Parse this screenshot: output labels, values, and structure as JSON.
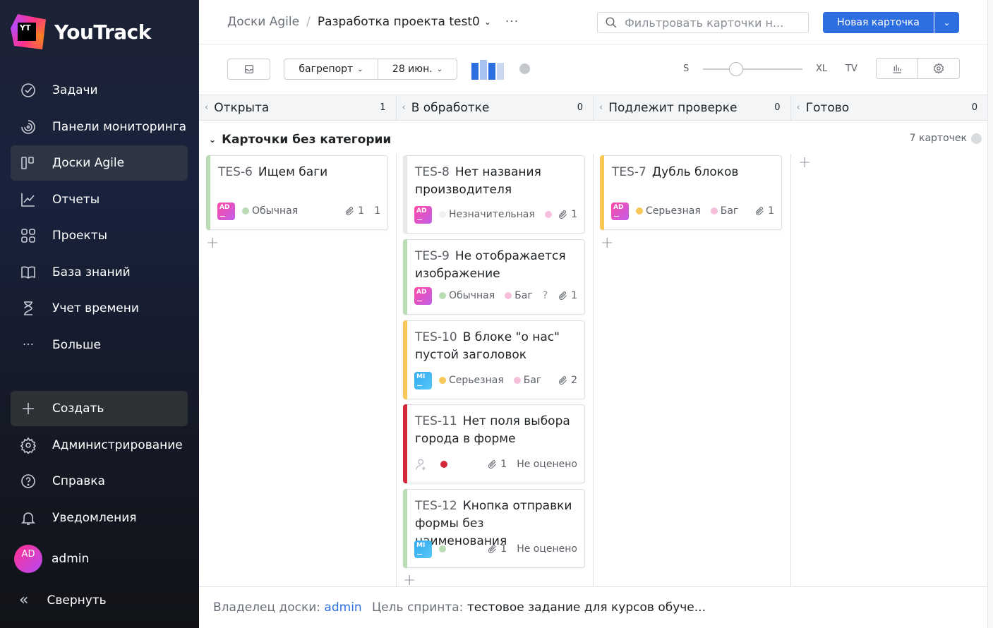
{
  "app": {
    "name": "YouTrack",
    "logo_text": "YT"
  },
  "sidebar": {
    "items": [
      {
        "label": "Задачи",
        "icon": "check-circle-icon"
      },
      {
        "label": "Панели мониторинга",
        "icon": "dashboard-icon"
      },
      {
        "label": "Доски Agile",
        "icon": "agile-board-icon",
        "active": true
      },
      {
        "label": "Отчеты",
        "icon": "chart-icon"
      },
      {
        "label": "Проекты",
        "icon": "grid-icon"
      },
      {
        "label": "База знаний",
        "icon": "book-icon"
      },
      {
        "label": "Учет времени",
        "icon": "hourglass-icon"
      },
      {
        "label": "Больше",
        "icon": "more-icon"
      }
    ],
    "bottom": [
      {
        "label": "Создать",
        "icon": "plus-icon"
      },
      {
        "label": "Администрирование",
        "icon": "gear-icon"
      },
      {
        "label": "Справка",
        "icon": "help-icon"
      },
      {
        "label": "Уведомления",
        "icon": "bell-icon"
      }
    ],
    "user": {
      "initials": "AD",
      "name": "admin"
    },
    "collapse_label": "Свернуть"
  },
  "topbar": {
    "breadcrumb_root": "Доски Agile",
    "breadcrumb_current": "Разработка проекта test0",
    "search_placeholder": "Фильтровать карточки н...",
    "new_card_label": "Новая карточка"
  },
  "toolbar": {
    "board_select": "багрепорт",
    "sprint_select": "28 июн.",
    "size_min": "S",
    "size_max": "XL",
    "tv_label": "TV"
  },
  "columns": [
    {
      "label": "Открыта",
      "count": "1"
    },
    {
      "label": "В обработке",
      "count": "0"
    },
    {
      "label": "Подлежит проверке",
      "count": "0"
    },
    {
      "label": "Готово",
      "count": "0"
    }
  ],
  "swimlane": {
    "title": "Карточки без категории",
    "count": "7 карточек"
  },
  "colors": {
    "normal": "#b9dcb5",
    "minor": "#e8e8e8",
    "major": "#f7c757",
    "critical": "#d2283a",
    "bug": "#f6c0dd",
    "accent": "#2d6fe0"
  },
  "cards": {
    "tes6": {
      "id": "TES-6",
      "title": "Ищем баги",
      "avatar": "AD",
      "priority": "Обычная",
      "attachments": "1",
      "votes": "1"
    },
    "tes7": {
      "id": "TES-7",
      "title": "Дубль блоков",
      "avatar": "AD",
      "priority": "Серьезная",
      "type": "Баг",
      "attachments": "1"
    },
    "tes8": {
      "id": "TES-8",
      "title": "Нет названия производителя",
      "avatar": "AD",
      "priority": "Незначительная",
      "attachments": "1"
    },
    "tes9": {
      "id": "TES-9",
      "title": "Не отображается изображение",
      "avatar": "AD",
      "priority": "Обычная",
      "type": "Баг",
      "unknown": "?",
      "attachments": "1"
    },
    "tes10": {
      "id": "TES-10",
      "title": "В блоке \"о нас\" пустой заголовок",
      "avatar": "MI",
      "priority": "Серьезная",
      "type": "Баг",
      "attachments": "2"
    },
    "tes11": {
      "id": "TES-11",
      "title": "Нет поля выбора города в форме",
      "attachments": "1",
      "estimate": "Не оценено"
    },
    "tes12": {
      "id": "TES-12",
      "title": "Кнопка отправки формы без наименования",
      "avatar": "MI",
      "attachments": "1",
      "estimate": "Не оценено"
    }
  },
  "footer": {
    "owner_label": "Владелец доски:",
    "owner_value": "admin",
    "goal_label": "Цель спринта:",
    "goal_value": "тестовое задание для курсов обуче..."
  }
}
